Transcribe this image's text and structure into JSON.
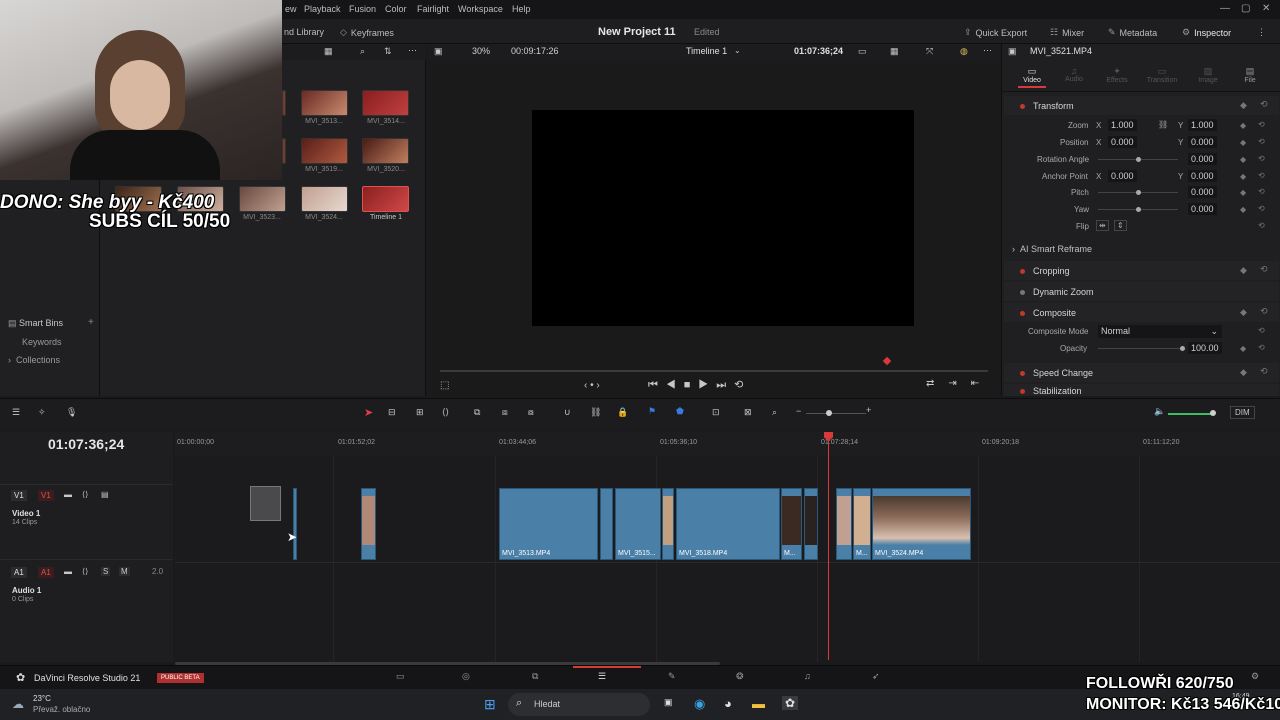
{
  "menubar": {
    "items": [
      "ew",
      "Playback",
      "Fusion",
      "Color",
      "Fairlight",
      "Workspace",
      "Help"
    ]
  },
  "toolbar": {
    "media_library": "nd Library",
    "keyframes": "Keyframes",
    "project_title": "New Project 11",
    "edited": "Edited",
    "quick_export": "Quick Export",
    "mixer": "Mixer",
    "metadata": "Metadata",
    "inspector": "Inspector"
  },
  "media_pool": {
    "clips": [
      {
        "label": "MVI_3513..."
      },
      {
        "label": "MVI_3514..."
      },
      {
        "label": "MVI_3519..."
      },
      {
        "label": "MVI_3520..."
      },
      {
        "label": "MVI_3523..."
      },
      {
        "label": "MVI_3524..."
      },
      {
        "label": "Timeline 1"
      }
    ],
    "smart_bins": "Smart Bins",
    "keywords": "Keywords",
    "collections": "Collections"
  },
  "viewer": {
    "zoom": "30%",
    "duration": "00:09:17:26",
    "timeline_name": "Timeline 1",
    "timecode": "01:07:36;24"
  },
  "inspector": {
    "clip_name": "MVI_3521.MP4",
    "tabs": [
      "Video",
      "Audio",
      "Effects",
      "Transition",
      "Image",
      "File"
    ],
    "transform": "Transform",
    "zoom_label": "Zoom",
    "zoom_x": "1.000",
    "zoom_y": "1.000",
    "position_label": "Position",
    "pos_x": "0.000",
    "pos_y": "0.000",
    "rotation_label": "Rotation Angle",
    "rotation": "0.000",
    "anchor_label": "Anchor Point",
    "anchor_x": "0.000",
    "anchor_y": "0.000",
    "pitch_label": "Pitch",
    "pitch": "0.000",
    "yaw_label": "Yaw",
    "yaw": "0.000",
    "flip_label": "Flip",
    "ai_reframe": "AI Smart Reframe",
    "cropping": "Cropping",
    "dynamic_zoom": "Dynamic Zoom",
    "composite": "Composite",
    "composite_mode_label": "Composite Mode",
    "composite_mode": "Normal",
    "opacity_label": "Opacity",
    "opacity": "100.00",
    "speed_change": "Speed Change",
    "stabilization": "Stabilization",
    "x": "X",
    "y": "Y"
  },
  "timeline": {
    "timecode": "01:07:36;24",
    "ruler": [
      "01:00:00;00",
      "01:01:52;02",
      "01:03:44;06",
      "01:05:36;10",
      "01:07:28;14",
      "01:09:20;18",
      "01:11:12;20"
    ],
    "dim": "DIM",
    "v1": "V1",
    "video_track": "Video 1",
    "video_clips": "14 Clips",
    "a1": "A1",
    "audio_track": "Audio 1",
    "audio_clips": "0 Clips",
    "audio_level": "2.0",
    "s": "S",
    "m": "M",
    "clips": [
      {
        "label": "MVI_3513.MP4"
      },
      {
        "label": "MVI_3515..."
      },
      {
        "label": "MVI_3518.MP4"
      },
      {
        "label": "M..."
      },
      {
        "label": "M..."
      },
      {
        "label": "MVI_3524.MP4"
      }
    ]
  },
  "pagebar": {
    "app_name": "DaVinci Resolve Studio 21",
    "badge": "PUBLIC BETA"
  },
  "taskbar": {
    "temp": "23°C",
    "weather": "Převaž. oblačno",
    "search": "Hledat",
    "time": "16:49"
  },
  "overlays": {
    "dono": "DONO: She byy - Kč400",
    "subs": "SUBS CÍL 50/50",
    "follow": "FOLLOWŘI 620/750",
    "monitor": "MONITOR: Kč13 546/Kč10"
  },
  "colors": {
    "clip_blue": "#4a7fa7",
    "playhead": "#d83a3a",
    "accent_red": "#c0392b"
  }
}
